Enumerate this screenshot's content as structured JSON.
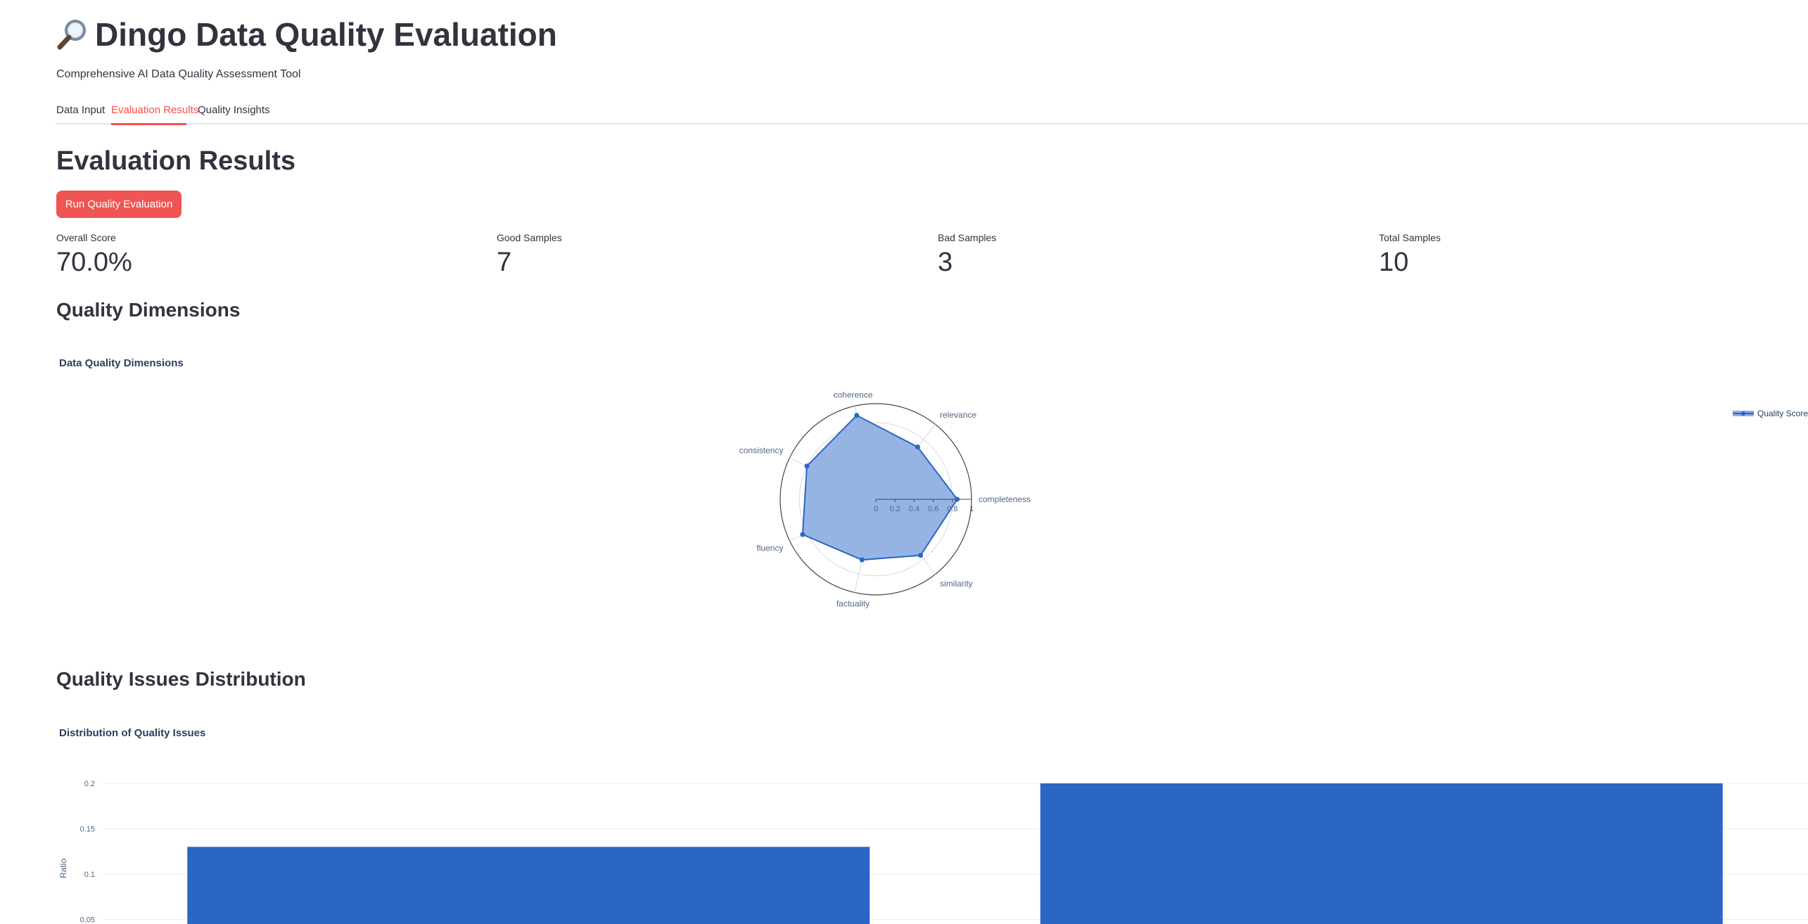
{
  "app": {
    "title": "Dingo Data Quality Evaluation",
    "subtitle": "Comprehensive AI Data Quality Assessment Tool"
  },
  "tabs": [
    {
      "label": "Data Input",
      "active": false
    },
    {
      "label": "Evaluation Results",
      "active": true
    },
    {
      "label": "Quality Insights",
      "active": false
    }
  ],
  "results": {
    "heading": "Evaluation Results",
    "run_button_label": "Run Quality Evaluation",
    "metrics": [
      {
        "label": "Overall Score",
        "value": "70.0%"
      },
      {
        "label": "Good Samples",
        "value": "7"
      },
      {
        "label": "Bad Samples",
        "value": "3"
      },
      {
        "label": "Total Samples",
        "value": "10"
      }
    ]
  },
  "dimensions": {
    "heading": "Quality Dimensions",
    "chart_title": "Data Quality Dimensions"
  },
  "issues": {
    "heading": "Quality Issues Distribution",
    "chart_title": "Distribution of Quality Issues"
  },
  "colors": {
    "accent": "#ff4b4b",
    "button": "#ef5552",
    "series": "#2a66c4",
    "radar_fill": "#8fb0e3"
  },
  "chart_data": [
    {
      "type": "radar",
      "title": "Data Quality Dimensions",
      "categories": [
        "completeness",
        "relevance",
        "coherence",
        "consistency",
        "fluency",
        "factuality",
        "similarity"
      ],
      "series": [
        {
          "name": "Quality Score",
          "values": [
            0.85,
            0.7,
            0.9,
            0.8,
            0.85,
            0.65,
            0.75
          ]
        }
      ],
      "radial_ticks": [
        "0",
        "0.2",
        "0.4",
        "0.6",
        "0.8",
        "1"
      ],
      "radial_range": [
        0,
        1
      ],
      "legend_position": "top-right"
    },
    {
      "type": "bar",
      "title": "Distribution of Quality Issues",
      "ylabel": "Ratio",
      "yticks": [
        "0.05",
        "0.1",
        "0.15",
        "0.2"
      ],
      "ylim": [
        0,
        0.2
      ],
      "series": [
        {
          "values": [
            0.13,
            0.2
          ]
        }
      ]
    }
  ]
}
